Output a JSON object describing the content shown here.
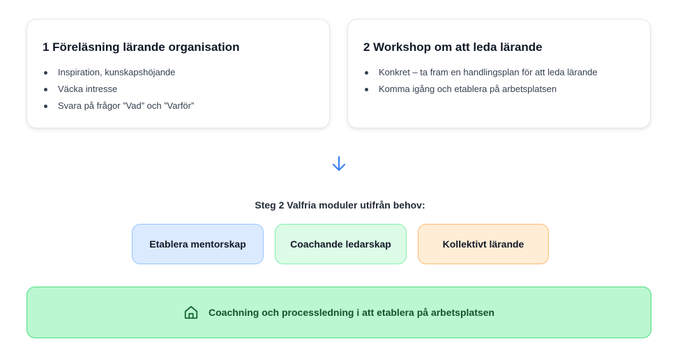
{
  "cards": [
    {
      "title": "1 Föreläsning lärande organisation",
      "bullets": [
        "Inspiration, kunskapshöjande",
        "Väcka intresse",
        "Svara på frågor ”Vad” och ”Varför”"
      ]
    },
    {
      "title": "2 Workshop om att leda lärande",
      "bullets": [
        "Konkret – ta fram en handlingsplan för att leda lärande",
        "Komma igång och etablera på arbetsplatsen"
      ]
    }
  ],
  "flow_icon": "arrow-down-icon",
  "step2": {
    "title": "Steg 2 Valfria moduler utifrån behov:",
    "modules": [
      "Etablera mentorskap",
      "Coachande ledarskap",
      "Kollektivt lärande"
    ]
  },
  "banner": {
    "icon": "home-icon",
    "text": "Coachning och processledning i att etablera på arbetsplatsen"
  },
  "colors": {
    "arrow": "#3b82f6",
    "module_blue": "#dbeafe",
    "module_green": "#dcfce7",
    "module_orange": "#ffedd5",
    "banner_bg": "#bbf7d0",
    "banner_text": "#14532d"
  }
}
